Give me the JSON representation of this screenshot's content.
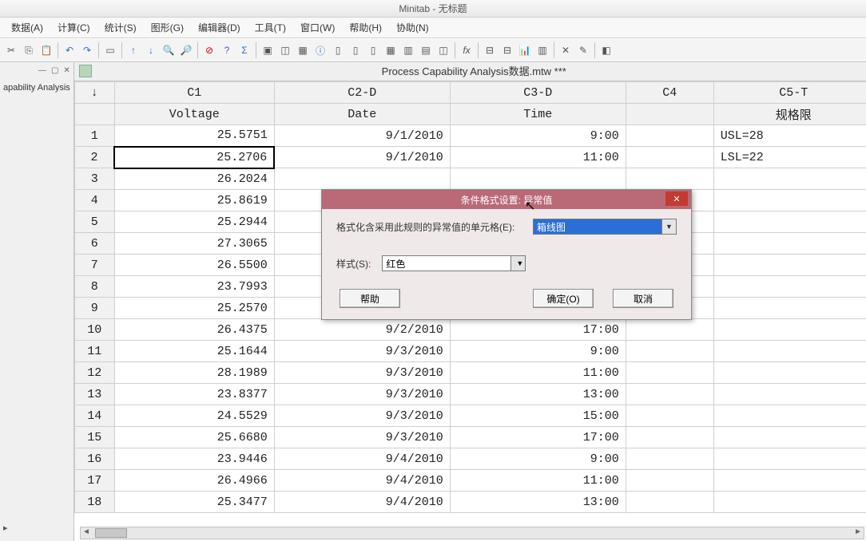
{
  "app_title": "Minitab - 无标题",
  "menu": [
    "数据(A)",
    "计算(C)",
    "统计(S)",
    "图形(G)",
    "编辑器(D)",
    "工具(T)",
    "窗口(W)",
    "帮助(H)",
    "协助(N)"
  ],
  "left_tree_label": "apability Analysis",
  "worksheet_title": "Process Capability Analysis数据.mtw ***",
  "columns": {
    "arrow": "↓",
    "c1_id": "C1",
    "c1_name": "Voltage",
    "c2_id": "C2-D",
    "c2_name": "Date",
    "c3_id": "C3-D",
    "c3_name": "Time",
    "c4_id": "C4",
    "c4_name": "",
    "c5_id": "C5-T",
    "c5_name": "规格限"
  },
  "rows": [
    {
      "n": "1",
      "c1": "25.5751",
      "c2": "9/1/2010",
      "c3": "9:00",
      "c5": "USL=28"
    },
    {
      "n": "2",
      "c1": "25.2706",
      "c2": "9/1/2010",
      "c3": "11:00",
      "c5": "LSL=22"
    },
    {
      "n": "3",
      "c1": "26.2024",
      "c2": "",
      "c3": "",
      "c5": ""
    },
    {
      "n": "4",
      "c1": "25.8619",
      "c2": "",
      "c3": "",
      "c5": ""
    },
    {
      "n": "5",
      "c1": "25.2944",
      "c2": "",
      "c3": "",
      "c5": ""
    },
    {
      "n": "6",
      "c1": "27.3065",
      "c2": "",
      "c3": "",
      "c5": ""
    },
    {
      "n": "7",
      "c1": "26.5500",
      "c2": "",
      "c3": "",
      "c5": ""
    },
    {
      "n": "8",
      "c1": "23.7993",
      "c2": "",
      "c3": "",
      "c5": ""
    },
    {
      "n": "9",
      "c1": "25.2570",
      "c2": "",
      "c3": "",
      "c5": ""
    },
    {
      "n": "10",
      "c1": "26.4375",
      "c2": "9/2/2010",
      "c3": "17:00",
      "c5": ""
    },
    {
      "n": "11",
      "c1": "25.1644",
      "c2": "9/3/2010",
      "c3": "9:00",
      "c5": ""
    },
    {
      "n": "12",
      "c1": "28.1989",
      "c2": "9/3/2010",
      "c3": "11:00",
      "c5": ""
    },
    {
      "n": "13",
      "c1": "23.8377",
      "c2": "9/3/2010",
      "c3": "13:00",
      "c5": ""
    },
    {
      "n": "14",
      "c1": "24.5529",
      "c2": "9/3/2010",
      "c3": "15:00",
      "c5": ""
    },
    {
      "n": "15",
      "c1": "25.6680",
      "c2": "9/3/2010",
      "c3": "17:00",
      "c5": ""
    },
    {
      "n": "16",
      "c1": "23.9446",
      "c2": "9/4/2010",
      "c3": "9:00",
      "c5": ""
    },
    {
      "n": "17",
      "c1": "26.4966",
      "c2": "9/4/2010",
      "c3": "11:00",
      "c5": ""
    },
    {
      "n": "18",
      "c1": "25.3477",
      "c2": "9/4/2010",
      "c3": "13:00",
      "c5": ""
    }
  ],
  "selected_cell": {
    "row_index": 1,
    "col": "c1"
  },
  "dialog": {
    "title": "条件格式设置: 异常值",
    "rule_label": "格式化含采用此规则的异常值的单元格(E):",
    "rule_value": "箱线图",
    "style_label": "样式(S):",
    "style_value": "红色",
    "btn_help": "帮助",
    "btn_ok": "确定(O)",
    "btn_cancel": "取消"
  }
}
